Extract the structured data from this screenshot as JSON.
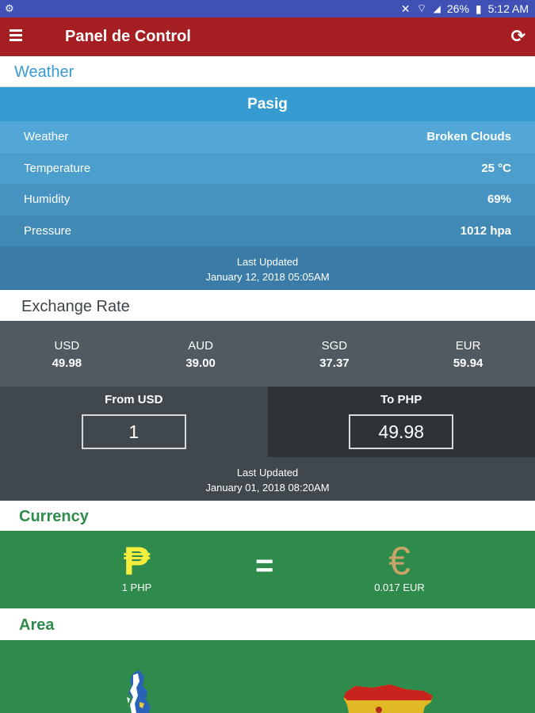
{
  "status_bar": {
    "battery": "26%",
    "time": "5:12 AM"
  },
  "app_bar": {
    "title": "Panel de Control"
  },
  "weather": {
    "header": "Weather",
    "city": "Pasig",
    "rows": [
      {
        "label": "Weather",
        "value": "Broken Clouds"
      },
      {
        "label": "Temperature",
        "value": "25 °C"
      },
      {
        "label": "Humidity",
        "value": "69%"
      },
      {
        "label": "Pressure",
        "value": "1012 hpa"
      }
    ],
    "updated_label": "Last Updated",
    "updated_value": "January 12, 2018 05:05AM"
  },
  "exchange": {
    "header": "Exchange Rate",
    "rates": [
      {
        "code": "USD",
        "value": "49.98"
      },
      {
        "code": "AUD",
        "value": "39.00"
      },
      {
        "code": "SGD",
        "value": "37.37"
      },
      {
        "code": "EUR",
        "value": "59.94"
      }
    ],
    "from_label": "From USD",
    "from_value": "1",
    "to_label": "To PHP",
    "to_value": "49.98",
    "updated_label": "Last Updated",
    "updated_value": "January 01, 2018  08:20AM"
  },
  "currency": {
    "header": "Currency",
    "left_symbol": "₱",
    "left_label": "1 PHP",
    "equals": "=",
    "right_symbol": "€",
    "right_label": "0.017 EUR"
  },
  "area": {
    "header": "Area"
  },
  "colors": {
    "app_bar": "#a51e22",
    "weather_header": "#359bd1",
    "currency_header": "#2e8b4b"
  }
}
